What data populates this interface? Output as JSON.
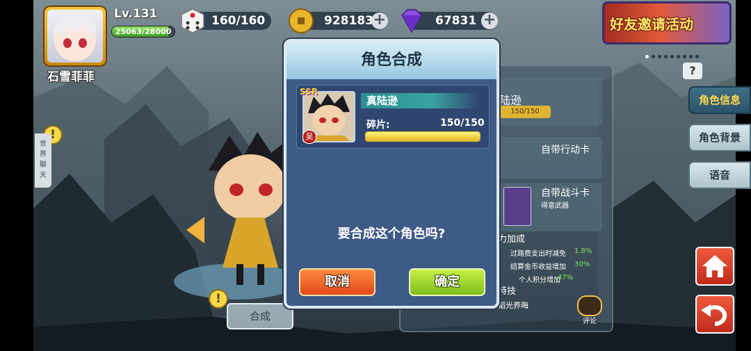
{
  "player": {
    "name": "石雪菲菲",
    "level": "Lv.131",
    "exp_text": "25063/28000",
    "exp_fraction": 0.895
  },
  "resources": {
    "dice": "160/160",
    "coins": "928183",
    "gems": "67831",
    "plus_symbol": "+"
  },
  "event_banner": {
    "label": "好友邀请活动"
  },
  "world_chat": {
    "label": "世界聊天"
  },
  "combine_button": {
    "label": "合成"
  },
  "right_tabs": [
    {
      "label": "角色信息",
      "active": true
    },
    {
      "label": "角色背景",
      "active": false
    },
    {
      "label": "语音",
      "active": false
    }
  ],
  "help_label": "?",
  "alert_symbol": "!",
  "info_panel": {
    "name_partial": "陆逊",
    "frag_partial": "150/150",
    "action_card": "自带行动卡",
    "battle_card": "自带战斗卡",
    "battle_card_sub": "得意武器",
    "bonus_title": "力加成",
    "bonuses": [
      {
        "label": "过路费支出时减免",
        "value": "1.8%"
      },
      {
        "label": "结算金币收益增加",
        "value": "30%"
      },
      {
        "label": "个人积分增加",
        "value": "47%"
      }
    ],
    "skill_title": "特技",
    "skill_name": "韬光养晦",
    "comment": "评论"
  },
  "modal": {
    "title": "角色合成",
    "rarity": "SSR",
    "faction": "吴",
    "character_name": "真陆逊",
    "fragment_label": "碎片:",
    "fragment_count": "150/150",
    "fragment_fraction": 1.0,
    "question": "要合成这个角色吗?",
    "cancel_label": "取消",
    "confirm_label": "确定"
  },
  "colors": {
    "modal_bg": "#3e5a87",
    "cancel": "#e0491a",
    "confirm": "#7fbe1d",
    "gold": "#f5c844"
  },
  "icons": [
    "dice-icon",
    "coin-icon",
    "gem-icon",
    "home-icon",
    "back-icon",
    "left-arrow-icon",
    "help-icon",
    "alert-icon"
  ]
}
